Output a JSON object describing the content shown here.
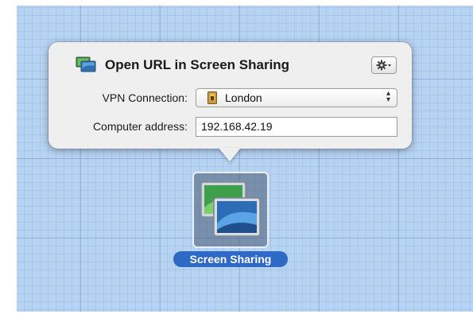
{
  "popover": {
    "title": "Open URL in Screen Sharing",
    "title_icon": "screen-sharing-icon",
    "gear_icon": "gear-icon"
  },
  "form": {
    "vpn_label": "VPN Connection:",
    "vpn_value": "London",
    "vpn_icon": "vpn-lock-icon",
    "address_label": "Computer address:",
    "address_value": "192.168.42.19"
  },
  "desktop": {
    "item_label": "Screen Sharing",
    "item_icon": "screen-sharing-icon"
  },
  "colors": {
    "canvas": "#b7d3f2",
    "selection": "#2f69c6",
    "popover": "#efefef"
  }
}
